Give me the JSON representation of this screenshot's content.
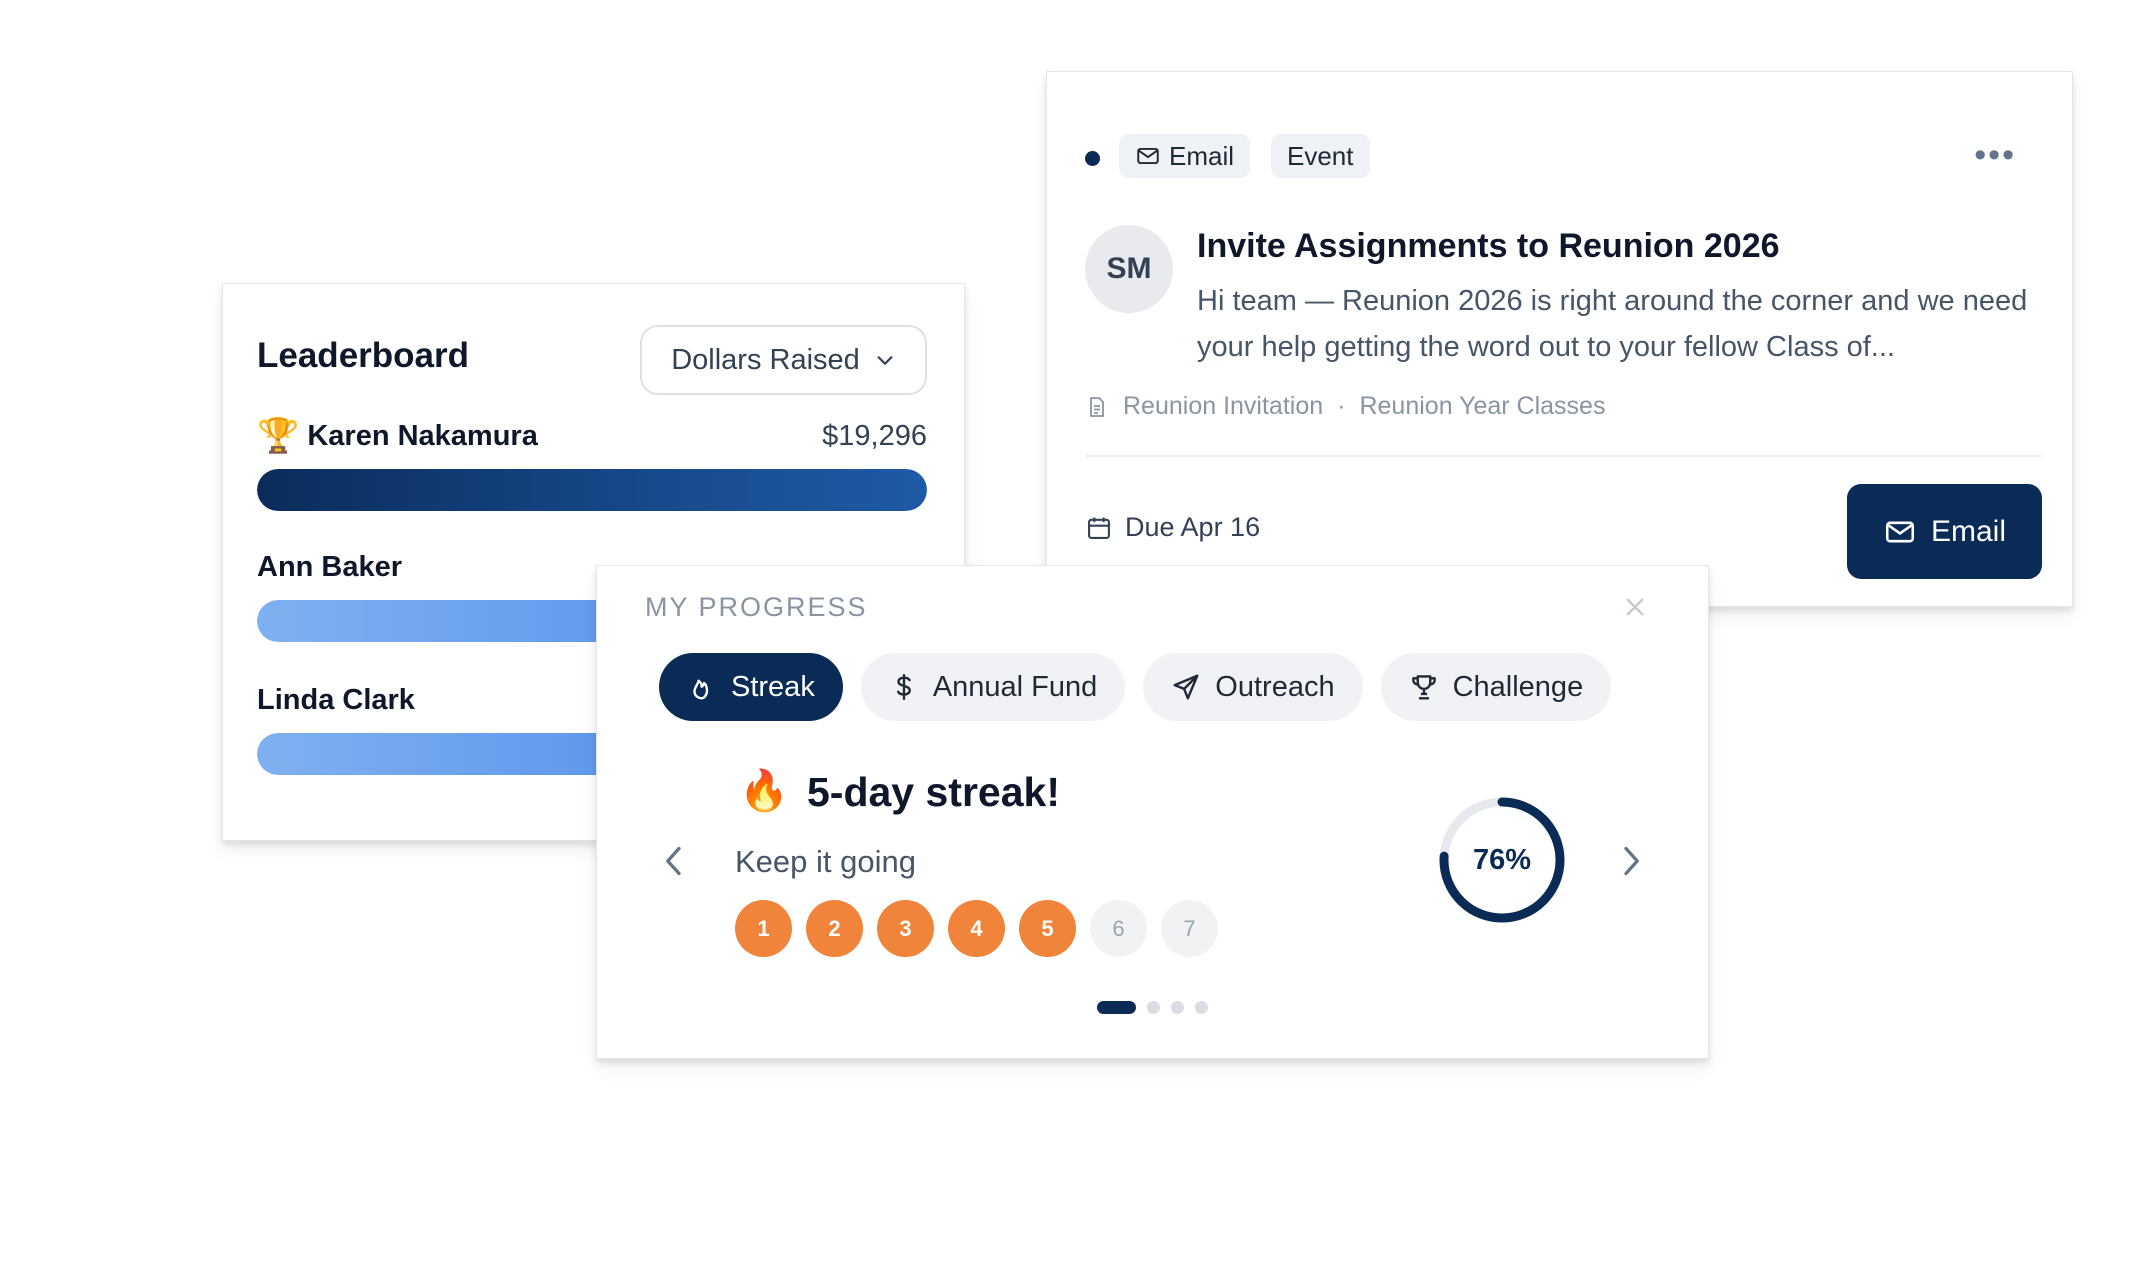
{
  "leaderboard": {
    "title": "Leaderboard",
    "metric_select": "Dollars Raised",
    "rows": [
      {
        "name": "Karen Nakamura",
        "amount": "$19,296",
        "rank_badge": "trophy-icon",
        "fill": 1.0
      },
      {
        "name": "Ann Baker",
        "amount": "",
        "fill": 0.62
      },
      {
        "name": "Linda Clark",
        "amount": "",
        "fill": 0.55
      }
    ]
  },
  "task": {
    "tags": [
      "Email",
      "Event"
    ],
    "avatar_initials": "SM",
    "title": "Invite Assignments to Reunion 2026",
    "body": "Hi team — Reunion 2026 is right around the corner and we need your help getting the word out to your fellow Class of...",
    "template": "Reunion Invitation",
    "separator": "·",
    "audience": "Reunion Year Classes",
    "due": "Due Apr 16",
    "action_label": "Email",
    "colors": {
      "primary": "#0b2b57",
      "unread_dot": "#0b2b57"
    }
  },
  "progress": {
    "eyebrow": "MY PROGRESS",
    "tabs": [
      {
        "label": "Streak",
        "icon": "flame-icon",
        "active": true
      },
      {
        "label": "Annual Fund",
        "icon": "dollar-icon",
        "active": false
      },
      {
        "label": "Outreach",
        "icon": "send-icon",
        "active": false
      },
      {
        "label": "Challenge",
        "icon": "trophy-icon",
        "active": false
      }
    ],
    "streak": {
      "emoji": "🔥",
      "title": "5-day streak!",
      "subtitle": "Keep it going",
      "days": [
        "1",
        "2",
        "3",
        "4",
        "5",
        "6",
        "7"
      ],
      "completed_days": 5
    },
    "percent": 76,
    "percent_label": "76%",
    "pager": {
      "total": 4,
      "current": 0
    },
    "colors": {
      "accent": "#f0843a",
      "primary": "#0b2b57"
    }
  }
}
